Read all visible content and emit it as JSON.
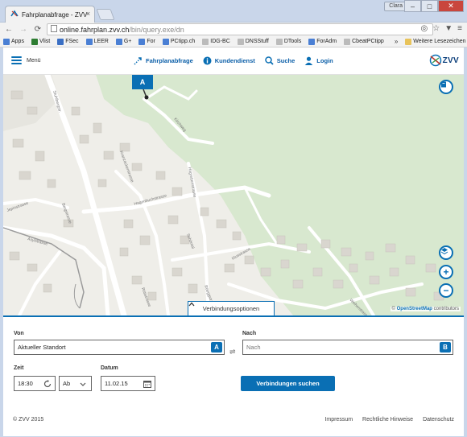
{
  "browser": {
    "tab_title": "Fahrplanabfrage - ZVV",
    "profile_name": "Clara",
    "url_host": "online.fahrplan.zvv.ch",
    "url_path": "/bin/query.exe/dn",
    "bookmarks": [
      {
        "label": "Apps",
        "color": "#4a7fd4"
      },
      {
        "label": "Vlist",
        "color": "#2e7d32"
      },
      {
        "label": "FSec",
        "color": "#3a6fc4"
      },
      {
        "label": "LEER",
        "color": "#4a7fd4"
      },
      {
        "label": "G+",
        "color": "#4a7fd4"
      },
      {
        "label": "For",
        "color": "#4a7fd4"
      },
      {
        "label": "PCtipp.ch",
        "color": "#4a7fd4"
      },
      {
        "label": "IDG-BC",
        "color": "#bbbbbb"
      },
      {
        "label": "DNSStuff",
        "color": "#bbbbbb"
      },
      {
        "label": "DTools",
        "color": "#bbbbbb"
      },
      {
        "label": "ForAdm",
        "color": "#4a7fd4"
      },
      {
        "label": "CbeatPCtipp",
        "color": "#bbbbbb"
      }
    ],
    "more_bookmarks": "»",
    "other_bookmarks": "Weitere Lesezeichen"
  },
  "header": {
    "menu_label": "Menü",
    "nav": [
      {
        "label": "Fahrplanabfrage",
        "icon": "route-icon"
      },
      {
        "label": "Kundendienst",
        "icon": "info-icon"
      },
      {
        "label": "Suche",
        "icon": "search-icon"
      },
      {
        "label": "Login",
        "icon": "user-icon"
      }
    ],
    "logo_text": "ZVV",
    "accent_color": "#0a6fb4"
  },
  "map": {
    "street_labels": [
      "Kirchweg",
      "Kranzackerstrasse",
      "Hagrebenstrasse",
      "Hagenbuchstrasse",
      "Schöntal",
      "Jepinstrasse",
      "Bergstrasse",
      "Asylstrasse",
      "Rütistrasse",
      "Klusstrasse",
      "Rüeggstrasse",
      "Weiherstrasse",
      "Stuhlbergstr."
    ],
    "pin_label": "A",
    "options_label": "Verbindungsoptionen",
    "attribution_prefix": "©",
    "attribution_link": "OpenStreetMap",
    "attribution_suffix": "contributors"
  },
  "form": {
    "from_label": "Von",
    "from_value": "Aktueller Standort",
    "from_badge": "A",
    "swap_symbol": "⇌",
    "to_label": "Nach",
    "to_placeholder": "Nach",
    "to_badge": "B",
    "time_label": "Zeit",
    "time_value": "18:30",
    "direction_value": "Ab",
    "date_label": "Datum",
    "date_value": "11.02.15",
    "search_button": "Verbindungen suchen"
  },
  "footer": {
    "copyright": "© ZVV 2015",
    "links": [
      "Impressum",
      "Rechtliche Hinweise",
      "Datenschutz"
    ]
  }
}
